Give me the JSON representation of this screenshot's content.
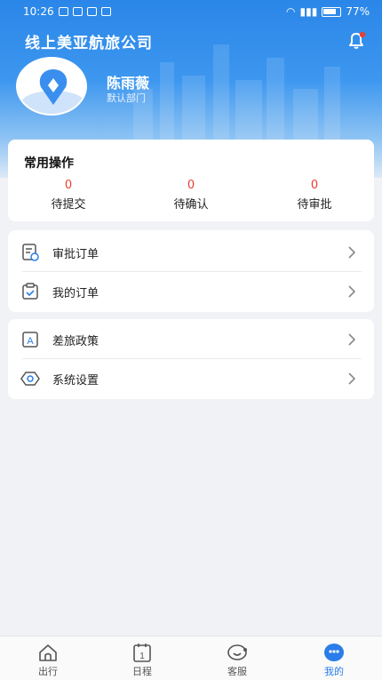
{
  "status_bar": {
    "time": "10:26",
    "battery": "77%"
  },
  "header": {
    "company": "线上美亚航旅公司"
  },
  "user": {
    "name": "陈雨薇",
    "department": "默认部门"
  },
  "common_ops": {
    "title": "常用操作",
    "items": [
      {
        "count": "0",
        "label": "待提交"
      },
      {
        "count": "0",
        "label": "待确认"
      },
      {
        "count": "0",
        "label": "待审批"
      }
    ]
  },
  "menu_group1": [
    {
      "label": "审批订单",
      "icon": "approval-doc-icon"
    },
    {
      "label": "我的订单",
      "icon": "clipboard-check-icon"
    }
  ],
  "menu_group2": [
    {
      "label": "差旅政策",
      "icon": "policy-a-icon"
    },
    {
      "label": "系统设置",
      "icon": "settings-icon"
    }
  ],
  "tabs": [
    {
      "label": "出行",
      "icon": "home-icon",
      "active": false
    },
    {
      "label": "日程",
      "icon": "calendar-icon",
      "active": false
    },
    {
      "label": "客服",
      "icon": "customer-service-icon",
      "active": false
    },
    {
      "label": "我的",
      "icon": "profile-icon",
      "active": true
    }
  ],
  "colors": {
    "accent": "#2b7de9",
    "badge_red": "#e8402f",
    "header_blue": "#2a86e8"
  }
}
